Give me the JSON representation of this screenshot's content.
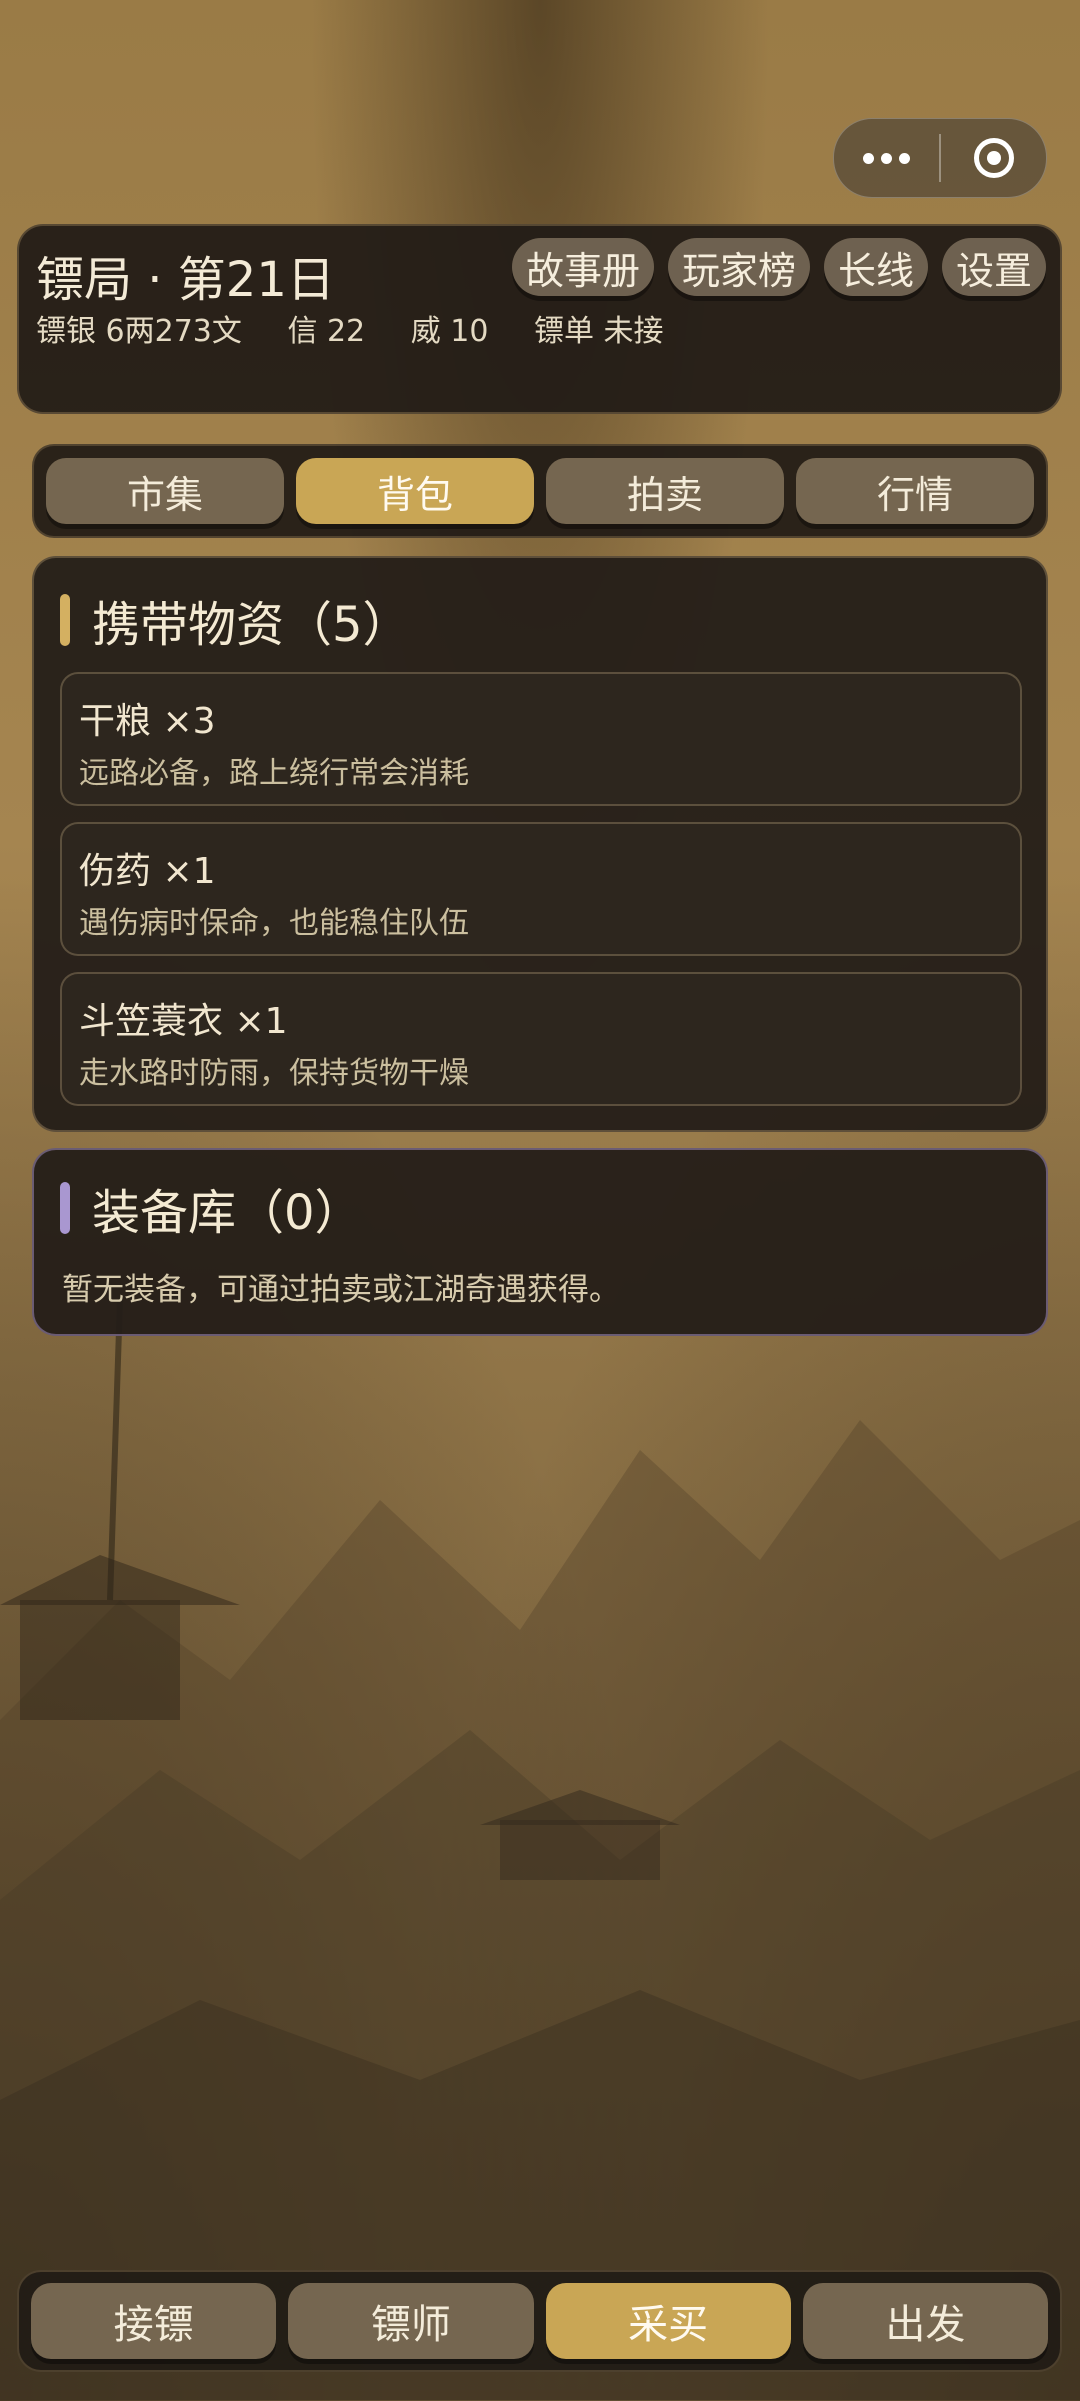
{
  "header": {
    "title": "镖局 · 第21日",
    "silver": "镖银 6两273文",
    "trust": "信 22",
    "prestige": "威 10",
    "order": "镖单 未接",
    "buttons": [
      "故事册",
      "玩家榜",
      "长线",
      "设置"
    ]
  },
  "tabs": [
    {
      "label": "市集",
      "active": false
    },
    {
      "label": "背包",
      "active": true
    },
    {
      "label": "拍卖",
      "active": false
    },
    {
      "label": "行情",
      "active": false
    }
  ],
  "inventory": {
    "title": "携带物资（5）",
    "items": [
      {
        "name": "干粮 ×3",
        "desc": "远路必备，路上绕行常会消耗"
      },
      {
        "name": "伤药 ×1",
        "desc": "遇伤病时保命，也能稳住队伍"
      },
      {
        "name": "斗笠蓑衣 ×1",
        "desc": "走水路时防雨，保持货物干燥"
      }
    ]
  },
  "equipment": {
    "title": "装备库（0）",
    "empty_text": "暂无装备，可通过拍卖或江湖奇遇获得。"
  },
  "bottom_nav": [
    {
      "label": "接镖",
      "active": false
    },
    {
      "label": "镖师",
      "active": false
    },
    {
      "label": "采买",
      "active": true
    },
    {
      "label": "出发",
      "active": false
    }
  ],
  "colors": {
    "accent_gold": "#c9a655",
    "panel_bg": "#241e18",
    "button_bg": "#756650",
    "equipment_accent": "#a997d0"
  },
  "icons": {
    "menu": "more-dots-icon",
    "close": "target-close-icon"
  }
}
